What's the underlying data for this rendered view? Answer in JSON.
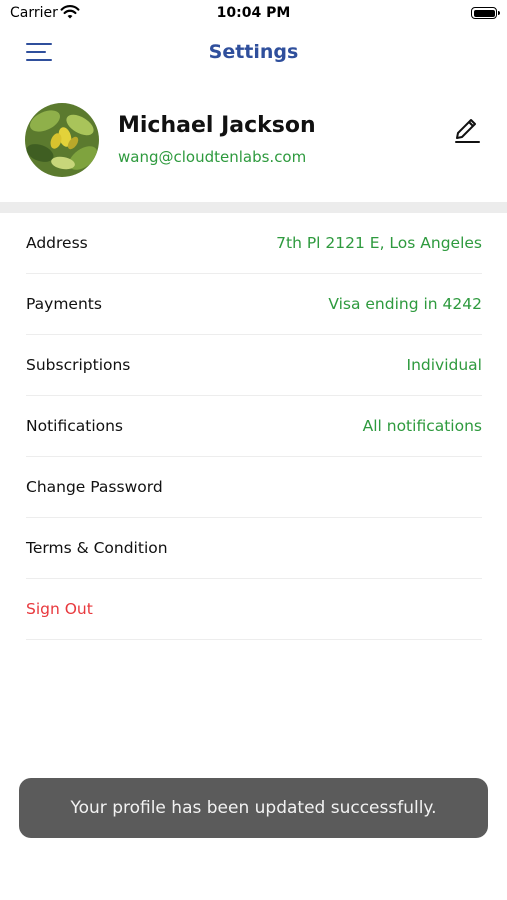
{
  "status_bar": {
    "carrier": "Carrier",
    "time": "10:04 PM",
    "icons": [
      "wifi-icon",
      "battery-icon"
    ]
  },
  "nav": {
    "title": "Settings",
    "menu_icon": "hamburger-menu-icon"
  },
  "profile": {
    "name": "Michael Jackson",
    "email": "wang@cloudtenlabs.com",
    "edit_icon": "pencil-icon"
  },
  "settings": [
    {
      "label": "Address",
      "value": "7th Pl 2121 E, Los Angeles"
    },
    {
      "label": "Payments",
      "value": "Visa ending in 4242"
    },
    {
      "label": "Subscriptions",
      "value": "Individual"
    },
    {
      "label": "Notifications",
      "value": "All notifications"
    },
    {
      "label": "Change Password",
      "value": ""
    },
    {
      "label": "Terms & Condition",
      "value": ""
    },
    {
      "label": "Sign Out",
      "value": ""
    }
  ],
  "toast": {
    "message": "Your profile has been updated successfully."
  },
  "colors": {
    "title": "#2f4f9c",
    "accent_green": "#2e9a3e",
    "danger": "#e8383d",
    "toast_bg": "#5b5b5b"
  }
}
